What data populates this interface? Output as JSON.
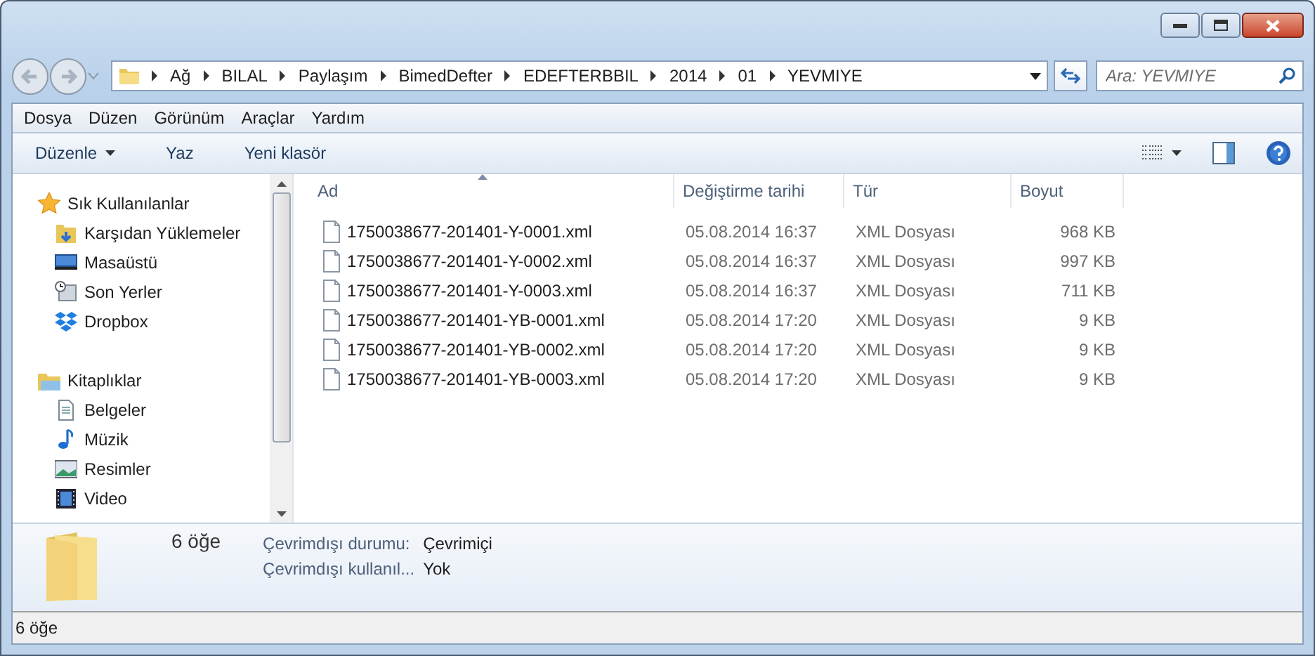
{
  "address": {
    "segments": [
      "Ağ",
      "BILAL",
      "Paylaşım",
      "BimedDefter",
      "EDEFTERBBIL",
      "2014",
      "01",
      "YEVMIYE"
    ]
  },
  "search": {
    "placeholder": "Ara: YEVMIYE"
  },
  "menu": [
    "Dosya",
    "Düzen",
    "Görünüm",
    "Araçlar",
    "Yardım"
  ],
  "toolbar": [
    {
      "label": "Düzenle",
      "dropdown": true
    },
    {
      "label": "Yaz",
      "dropdown": false
    },
    {
      "label": "Yeni klasör",
      "dropdown": false
    }
  ],
  "sidebar": {
    "groups": [
      {
        "label": "Sık Kullanılanlar",
        "children": [
          {
            "label": "Karşıdan Yüklemeler"
          },
          {
            "label": "Masaüstü"
          },
          {
            "label": "Son Yerler"
          },
          {
            "label": "Dropbox"
          }
        ]
      },
      {
        "label": "Kitaplıklar",
        "children": [
          {
            "label": "Belgeler"
          },
          {
            "label": "Müzik"
          },
          {
            "label": "Resimler"
          },
          {
            "label": "Video"
          }
        ]
      }
    ]
  },
  "table": {
    "columns": [
      {
        "label": "Ad",
        "sorted": true
      },
      {
        "label": "Değiştirme tarihi",
        "sorted": false
      },
      {
        "label": "Tür",
        "sorted": false
      },
      {
        "label": "Boyut",
        "sorted": false
      }
    ],
    "rows": [
      [
        "1750038677-201401-Y-0001.xml",
        "05.08.2014 16:37",
        "XML Dosyası",
        "968 KB"
      ],
      [
        "1750038677-201401-Y-0002.xml",
        "05.08.2014 16:37",
        "XML Dosyası",
        "997 KB"
      ],
      [
        "1750038677-201401-Y-0003.xml",
        "05.08.2014 16:37",
        "XML Dosyası",
        "711 KB"
      ],
      [
        "1750038677-201401-YB-0001.xml",
        "05.08.2014 17:20",
        "XML Dosyası",
        "9 KB"
      ],
      [
        "1750038677-201401-YB-0002.xml",
        "05.08.2014 17:20",
        "XML Dosyası",
        "9 KB"
      ],
      [
        "1750038677-201401-YB-0003.xml",
        "05.08.2014 17:20",
        "XML Dosyası",
        "9 KB"
      ]
    ]
  },
  "details": {
    "count": "6 öğe",
    "fields": [
      {
        "label": "Çevrimdışı durumu:",
        "value": "Çevrimiçi"
      },
      {
        "label": "Çevrimdışı kullanıl...",
        "value": "Yok"
      }
    ]
  },
  "status_bar": "6 öğe"
}
